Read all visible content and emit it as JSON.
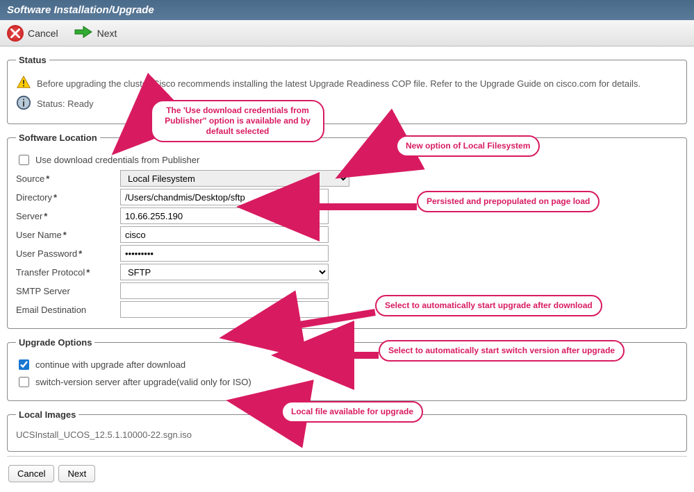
{
  "title": "Software Installation/Upgrade",
  "toolbar": {
    "cancel": "Cancel",
    "next": "Next"
  },
  "status": {
    "legend": "Status",
    "warn_msg": "Before upgrading the cluster Cisco recommends installing the latest Upgrade Readiness COP file. Refer to the Upgrade Guide on cisco.com for details.",
    "ready_msg": "Status: Ready"
  },
  "location": {
    "legend": "Software Location",
    "use_pub_label": "Use download credentials from Publisher",
    "use_pub_checked": false,
    "source_label": "Source",
    "source_value": "Local Filesystem",
    "directory_label": "Directory",
    "directory_value": "/Users/chandmis/Desktop/sftp",
    "server_label": "Server",
    "server_value": "10.66.255.190",
    "user_label": "User Name",
    "user_value": "cisco",
    "password_label": "User Password",
    "password_value": "•••••••••",
    "protocol_label": "Transfer Protocol",
    "protocol_value": "SFTP",
    "smtp_label": "SMTP Server",
    "smtp_value": "",
    "email_label": "Email Destination",
    "email_value": ""
  },
  "options": {
    "legend": "Upgrade Options",
    "continue_label": "continue with upgrade after download",
    "continue_checked": true,
    "switch_label": "switch-version server after upgrade(valid only for ISO)",
    "switch_checked": false
  },
  "local": {
    "legend": "Local Images",
    "file": "UCSInstall_UCOS_12.5.1.10000-22.sgn.iso"
  },
  "buttons": {
    "cancel": "Cancel",
    "next": "Next"
  },
  "annotations": {
    "a1": "The 'Use download credentials from Publisher\" option is available and by default selected",
    "a2": "New option of Local Filesystem",
    "a3": "Persisted and prepopulated on page load",
    "a4": "Select to automatically start  upgrade after download",
    "a5": "Select to automatically start switch version after upgrade",
    "a6": "Local file available for upgrade"
  }
}
